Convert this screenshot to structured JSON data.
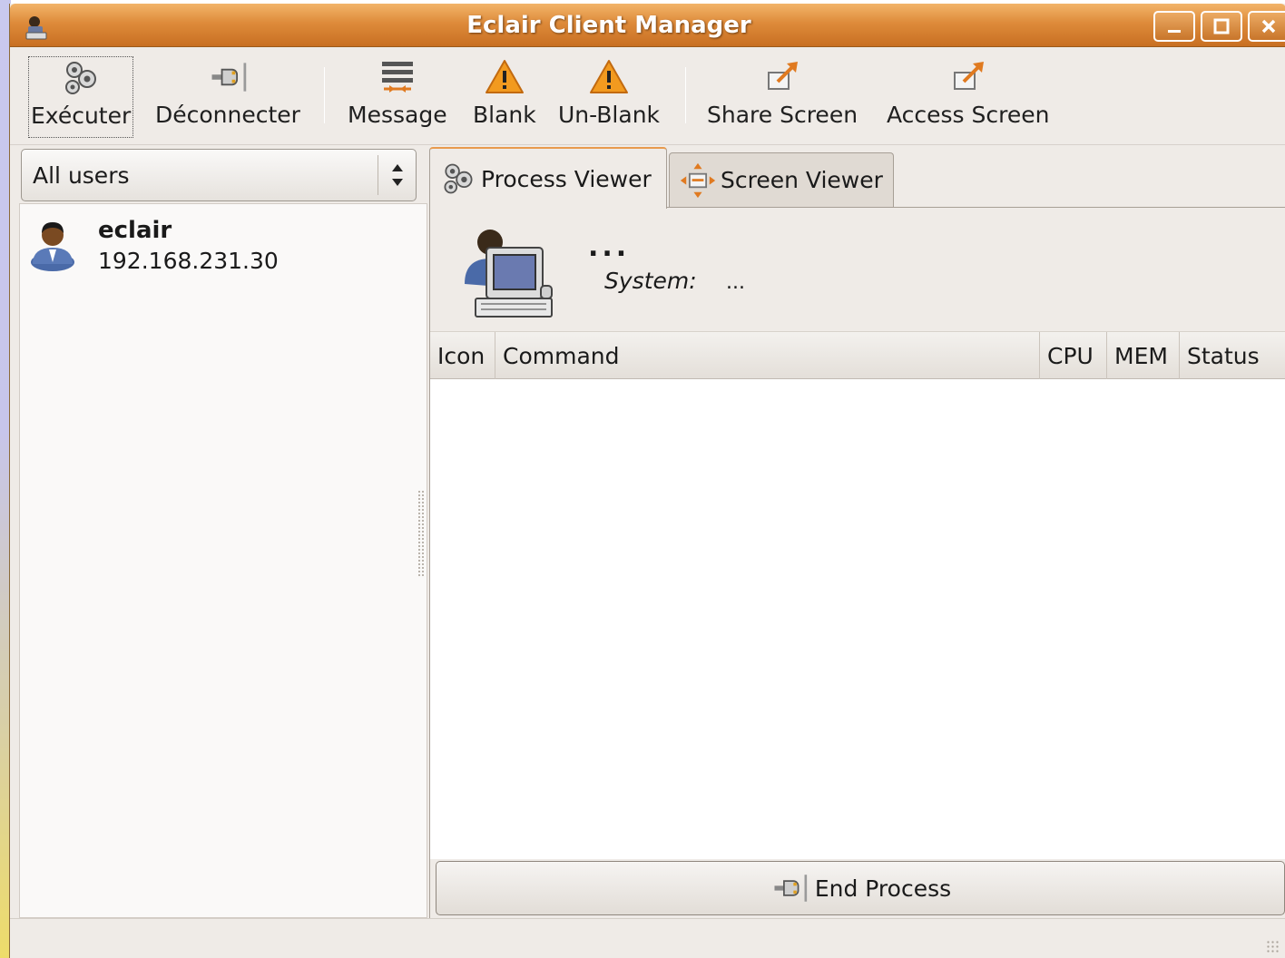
{
  "window": {
    "title": "Eclair Client Manager"
  },
  "toolbar": {
    "items": [
      {
        "label": "Exécuter",
        "icon": "gears-icon"
      },
      {
        "label": "Déconnecter",
        "icon": "plug-icon"
      },
      {
        "label": "Message",
        "icon": "message-icon"
      },
      {
        "label": "Blank",
        "icon": "warning-icon"
      },
      {
        "label": "Un-Blank",
        "icon": "warning-icon"
      },
      {
        "label": "Share Screen",
        "icon": "share-screen-icon"
      },
      {
        "label": "Access Screen",
        "icon": "access-screen-icon"
      }
    ]
  },
  "sidebar": {
    "filter": {
      "selected": "All users"
    },
    "users": [
      {
        "name": "eclair",
        "ip": "192.168.231.30"
      }
    ]
  },
  "tabs": [
    {
      "label": "Process Viewer",
      "icon": "gears-icon",
      "active": true
    },
    {
      "label": "Screen Viewer",
      "icon": "screen-move-icon",
      "active": false
    }
  ],
  "process_viewer": {
    "hostname": "...",
    "system_label": "System:",
    "system_value": "...",
    "columns": [
      "Icon",
      "Command",
      "CPU",
      "MEM",
      "Status"
    ],
    "rows": [],
    "end_button": "End Process"
  },
  "colors": {
    "titlebar": "#de8b3a",
    "window_bg": "#efebe7",
    "accent": "#e89a4d"
  }
}
